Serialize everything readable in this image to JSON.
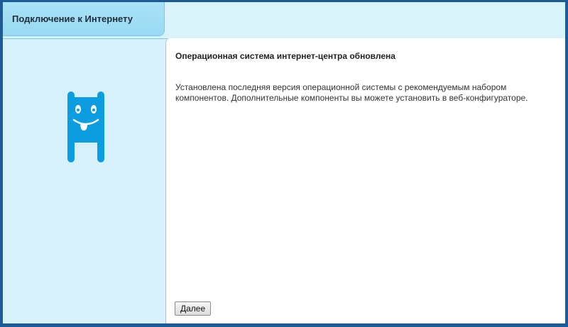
{
  "header": {
    "tab_label": "Подключение к Интернету"
  },
  "sidebar": {
    "logo_icon": "keenetic-monster-icon",
    "logo_color": "#0b9de0"
  },
  "main": {
    "title": "Операционная система интернет-центра обновлена",
    "description": "Установлена последняя версия операционной системы с рекомендуемым набором компонентов. Дополнительные компоненты вы можете установить в веб-конфигураторе.",
    "next_button_label": "Далее"
  },
  "colors": {
    "frame_border": "#1e5a96",
    "tab_background": "#a8e2f8",
    "sidebar_background": "#d7f1fb",
    "content_background": "#ffffff"
  }
}
